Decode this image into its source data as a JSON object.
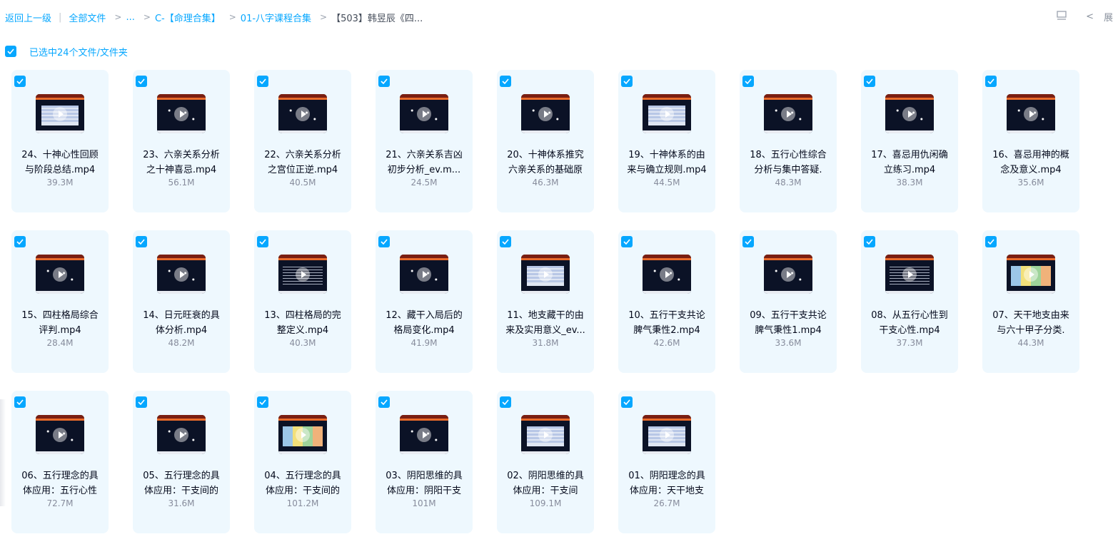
{
  "breadcrumb": {
    "back": "返回上一级",
    "all_files": "全部文件",
    "ellipsis": "...",
    "level1": "C-【命理合集】",
    "level2": "01-八字课程合集",
    "current": "【503】韩昱辰《四..."
  },
  "toolbar": {
    "expand_label": "展"
  },
  "selection": {
    "text": "已选中24个文件/文件夹"
  },
  "files": [
    {
      "name": "24、十神心性回顾与阶段总结.mp4",
      "size": "39.3M",
      "thumb": "table"
    },
    {
      "name": "23、六亲关系分析之十神喜忌.mp4",
      "size": "56.1M",
      "thumb": "dark"
    },
    {
      "name": "22、六亲关系分析之宫位正逆.mp4",
      "size": "40.5M",
      "thumb": "dark"
    },
    {
      "name": "21、六亲关系吉凶初步分析_ev.m...",
      "size": "24.5M",
      "thumb": "dark"
    },
    {
      "name": "20、十神体系推究六亲关系的基础原",
      "size": "46.3M",
      "thumb": "dark"
    },
    {
      "name": "19、十神体系的由来与确立规则.mp4",
      "size": "44.5M",
      "thumb": "table"
    },
    {
      "name": "18、五行心性综合分析与集中答疑.",
      "size": "48.3M",
      "thumb": "dark"
    },
    {
      "name": "17、喜忌用仇闲确立练习.mp4",
      "size": "38.3M",
      "thumb": "dark"
    },
    {
      "name": "16、喜忌用神的概念及意义.mp4",
      "size": "35.6M",
      "thumb": "dark"
    },
    {
      "name": "15、四柱格局综合评判.mp4",
      "size": "28.4M",
      "thumb": "dark"
    },
    {
      "name": "14、日元旺衰的具体分析.mp4",
      "size": "48.2M",
      "thumb": "dark"
    },
    {
      "name": "13、四柱格局的完整定义.mp4",
      "size": "40.3M",
      "thumb": "text"
    },
    {
      "name": "12、藏干入局后的格局变化.mp4",
      "size": "41.9M",
      "thumb": "dark"
    },
    {
      "name": "11、地支藏干的由来及实用意义_ev...",
      "size": "31.8M",
      "thumb": "table"
    },
    {
      "name": "10、五行干支共论脾气秉性2.mp4",
      "size": "42.6M",
      "thumb": "dark"
    },
    {
      "name": "09、五行干支共论脾气秉性1.mp4",
      "size": "33.6M",
      "thumb": "dark"
    },
    {
      "name": "08、从五行心性到干支心性.mp4",
      "size": "37.3M",
      "thumb": "text"
    },
    {
      "name": "07、天干地支由来与六十甲子分类.",
      "size": "44.3M",
      "thumb": "color"
    },
    {
      "name": "06、五行理念的具体应用：五行心性",
      "size": "72.7M",
      "thumb": "dark"
    },
    {
      "name": "05、五行理念的具体应用：干支间的",
      "size": "31.6M",
      "thumb": "dark"
    },
    {
      "name": "04、五行理念的具体应用：干支间的",
      "size": "101.2M",
      "thumb": "color"
    },
    {
      "name": "03、阴阳思维的具体应用：阴阳干支",
      "size": "101M",
      "thumb": "dark"
    },
    {
      "name": "02、阴阳思维的具体应用：干支间",
      "size": "109.1M",
      "thumb": "table"
    },
    {
      "name": "01、阴阳理念的具体应用：天干地支",
      "size": "26.7M",
      "thumb": "table"
    }
  ]
}
